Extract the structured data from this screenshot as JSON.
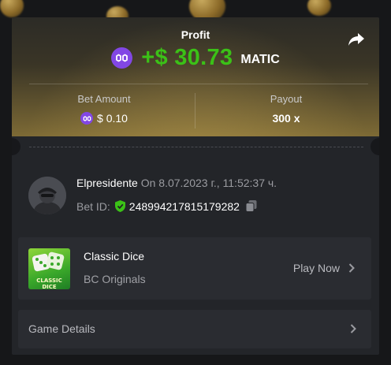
{
  "profit": {
    "label": "Profit",
    "amount": "+$ 30.73",
    "currency": "MATIC"
  },
  "stats": {
    "bet_amount_label": "Bet Amount",
    "bet_amount_value": "$ 0.10",
    "payout_label": "Payout",
    "payout_value": "300 x"
  },
  "bet": {
    "username": "Elpresidente",
    "date": "On 8.07.2023 г., 11:52:37 ч.",
    "bet_id_label": "Bet ID:",
    "bet_id_value": "248994217815179282"
  },
  "game": {
    "name": "Classic Dice",
    "provider": "BC Originals",
    "thumb_text": "CLASSIC DICE",
    "play_label": "Play Now"
  },
  "details": {
    "label": "Game Details"
  },
  "colors": {
    "profit_green": "#3bc117",
    "matic_purple": "#8247e5",
    "card_bg": "#232529",
    "panel_bg": "#2a2c31"
  },
  "icons": [
    "matic-icon",
    "share-icon",
    "verified-shield-icon",
    "copy-icon",
    "chevron-right-icon"
  ]
}
